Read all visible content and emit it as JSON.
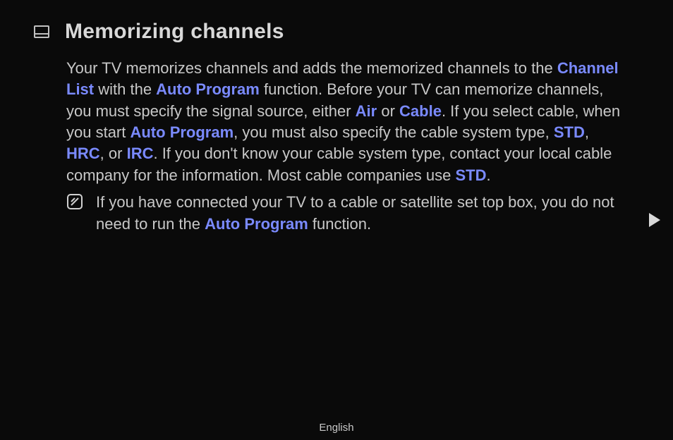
{
  "title": "Memorizing channels",
  "para1": {
    "t1": "Your TV memorizes channels and adds the memorized channels to the ",
    "channel_list": "Channel List",
    "t2": " with the ",
    "auto_program1": "Auto Program",
    "t3": " function. Before your TV can memorize channels, you must specify the signal source, either ",
    "air": "Air",
    "t4": " or ",
    "cable": "Cable",
    "t5": ". If you select cable, when you start ",
    "auto_program2": "Auto Program",
    "t6": ", you must also specify the cable system type, ",
    "std1": "STD",
    "t7": ", ",
    "hrc": "HRC",
    "t8": ", or ",
    "irc": "IRC",
    "t9": ". If you don't know your cable system type, contact your local cable company for the information. Most cable companies use ",
    "std2": "STD",
    "t10": "."
  },
  "note": {
    "t1": "If you have connected your TV to a cable or satellite set top box, you do not need to run the ",
    "auto_program": "Auto Program",
    "t2": " function."
  },
  "footer": "English"
}
